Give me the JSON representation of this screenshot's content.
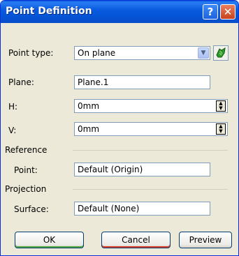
{
  "window": {
    "title": "Point Definition",
    "help_glyph": "?",
    "close_glyph": "✕"
  },
  "fields": {
    "point_type": {
      "label": "Point type:",
      "value": "On plane"
    },
    "plane": {
      "label": "Plane:",
      "value": "Plane.1"
    },
    "h": {
      "label": "H:",
      "value": "0mm"
    },
    "v": {
      "label": "V:",
      "value": "0mm"
    }
  },
  "reference": {
    "title": "Reference",
    "point": {
      "label": "Point:",
      "value": "Default (Origin)"
    }
  },
  "projection": {
    "title": "Projection",
    "surface": {
      "label": "Surface:",
      "value": "Default (None)"
    }
  },
  "buttons": {
    "ok": "OK",
    "cancel": "Cancel",
    "preview": "Preview"
  },
  "colors": {
    "title_bar": "#0a5ce0",
    "dialog_bg": "#ece9d8",
    "ok_accent": "#52a840",
    "cancel_accent": "#d83a2a"
  },
  "icons": {
    "dropdown": "chevron-down-icon",
    "pick": "point-pick-icon",
    "help": "help-icon",
    "close": "close-icon"
  }
}
